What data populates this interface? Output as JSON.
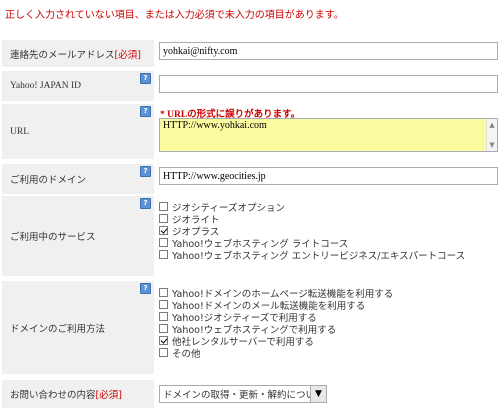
{
  "error_message": "正しく入力されていない項目、または入力必須で未入力の項目があります。",
  "fields": {
    "email": {
      "label": "連絡先のメールアドレス",
      "required": "[必須]",
      "value": "yohkai@nifty.com"
    },
    "yahoo_id": {
      "label": "Yahoo! JAPAN ID",
      "value": ""
    },
    "url": {
      "label": "URL",
      "error": "* URLの形式に誤りがあります。",
      "value": "HTTP://www.yohkai.com"
    },
    "domain": {
      "label": "ご利用のドメイン",
      "value": "HTTP://www.geocities.jp"
    },
    "services": {
      "label": "ご利用中のサービス",
      "options": [
        {
          "label": "ジオシティーズオプション",
          "checked": false
        },
        {
          "label": "ジオライト",
          "checked": false
        },
        {
          "label": "ジオプラス",
          "checked": true
        },
        {
          "label": "Yahoo!ウェブホスティング ライトコース",
          "checked": false
        },
        {
          "label": "Yahoo!ウェブホスティング エントリービジネス/エキスパートコース",
          "checked": false
        }
      ]
    },
    "domain_usage": {
      "label": "ドメインのご利用方法",
      "options": [
        {
          "label": "Yahoo!ドメインのホームページ転送機能を利用する",
          "checked": false
        },
        {
          "label": "Yahoo!ドメインのメール転送機能を利用する",
          "checked": false
        },
        {
          "label": "Yahoo!ジオシティーズで利用する",
          "checked": false
        },
        {
          "label": "Yahoo!ウェブホスティングで利用する",
          "checked": false
        },
        {
          "label": "他社レンタルサーバーで利用する",
          "checked": true
        },
        {
          "label": "その他",
          "checked": false
        }
      ]
    },
    "inquiry": {
      "label": "お問い合わせの内容",
      "required": "[必須]",
      "selected": "ドメインの取得・更新・解約について"
    }
  },
  "colors": {
    "error": "#cc0000",
    "label_bg": "#f0f0f0",
    "invalid_field_bg": "#fbfba0",
    "help_icon": "#5b93d4"
  },
  "icons": {
    "help": "help-icon",
    "checkbox": "checkbox-icon",
    "dropdown": "chevron-down-icon"
  }
}
